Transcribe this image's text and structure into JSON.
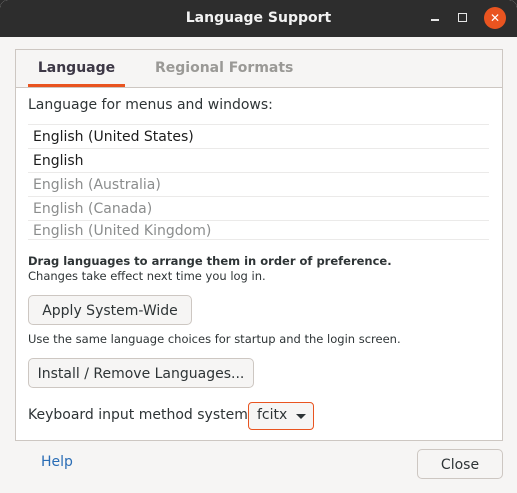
{
  "window": {
    "title": "Language Support",
    "accent_color": "#e95420",
    "controls": {
      "minimize_icon": "minimize-icon",
      "maximize_icon": "maximize-icon",
      "close_icon": "close-icon",
      "close_glyph": "✕"
    }
  },
  "tabs": [
    {
      "label": "Language",
      "active": true
    },
    {
      "label": "Regional Formats",
      "active": false
    }
  ],
  "language": {
    "heading": "Language for menus and windows:",
    "languages": [
      {
        "label": "English (United States)",
        "installed": true
      },
      {
        "label": "English",
        "installed": true
      },
      {
        "label": "English (Australia)",
        "installed": false
      },
      {
        "label": "English (Canada)",
        "installed": false
      },
      {
        "label": "English (United Kingdom)",
        "installed": false
      }
    ],
    "drag_hint": "Drag languages to arrange them in order of preference.",
    "changes_note": "Changes take effect next time you log in.",
    "apply_button": "Apply System-Wide",
    "apply_note": "Use the same language choices for startup and the login screen.",
    "install_button": "Install / Remove Languages...",
    "keyboard_label": "Keyboard input method system:",
    "keyboard_value": "fcitx"
  },
  "footer": {
    "help": "Help",
    "close": "Close"
  }
}
